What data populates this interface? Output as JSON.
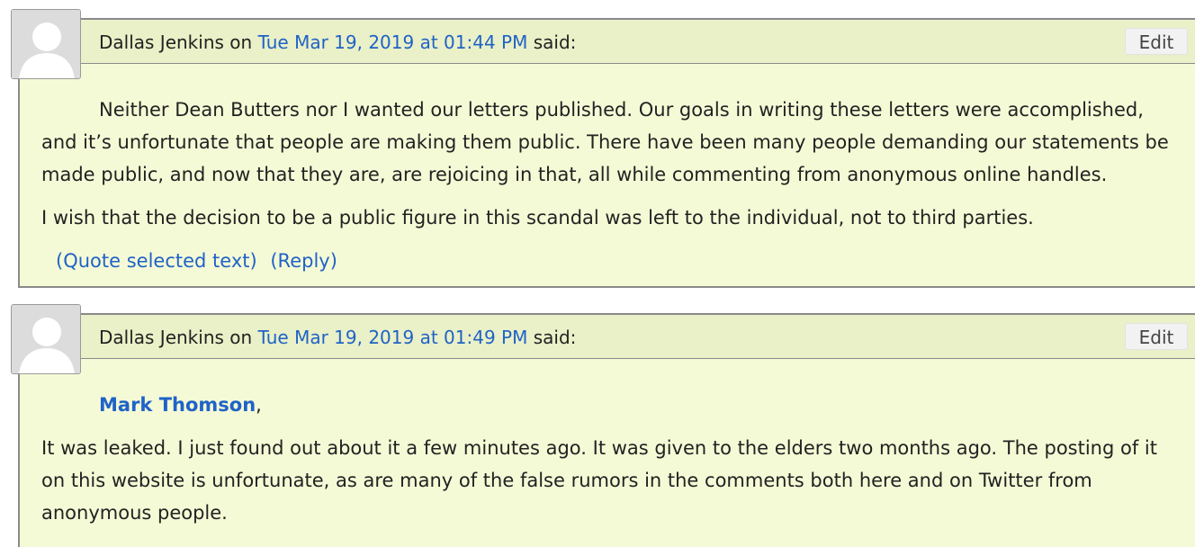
{
  "comments": [
    {
      "author": "Dallas Jenkins",
      "on_text": " on ",
      "date": "Tue Mar 19, 2019 at 01:44 PM",
      "said_text": " said:",
      "edit_label": "Edit",
      "paragraphs": [
        "Neither Dean Butters nor I wanted our letters published. Our goals in writing these letters were accomplished, and it’s unfortunate that people are making them public. There have been many people demanding our statements be made public, and now that they are, are rejoicing in that, all while commenting from anonymous online handles.",
        "I wish that the decision to be a public figure in this scandal was left to the individual, not to third parties."
      ],
      "quote_label": "(Quote selected text)",
      "reply_label": "(Reply)"
    },
    {
      "author": "Dallas Jenkins",
      "on_text": " on ",
      "date": "Tue Mar 19, 2019 at 01:49 PM",
      "said_text": " said:",
      "edit_label": "Edit",
      "mention": "Mark Thomson",
      "mention_suffix": ",",
      "paragraphs": [
        "It was leaked. I just found out about it a few minutes ago. It was given to the elders two months ago. The posting of it on this website is unfortunate, as are many of the false rumors in the comments both here and on Twitter from anonymous people."
      ]
    }
  ],
  "colors": {
    "link": "#1f63c7",
    "comment_bg": "#f5fad6",
    "header_bg": "#eaf0c7"
  }
}
